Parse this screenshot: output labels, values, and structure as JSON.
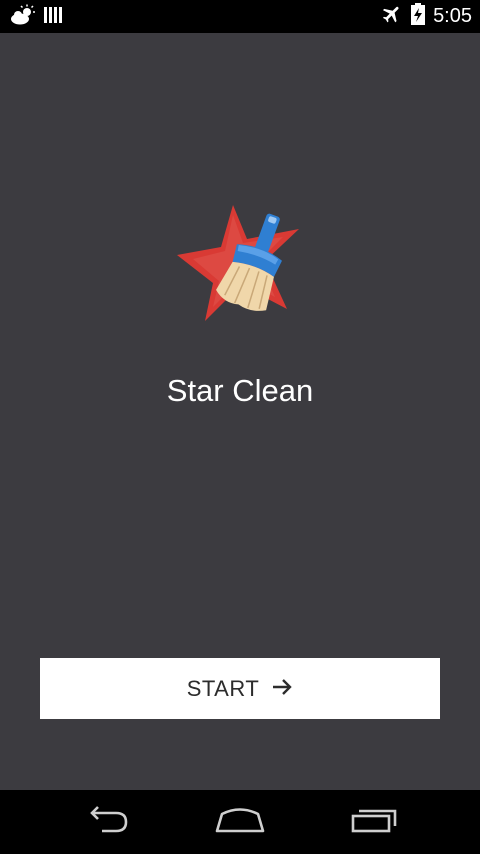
{
  "status_bar": {
    "time": "5:05",
    "icons": [
      "weather-icon",
      "signal-bars-icon",
      "airplane-icon",
      "battery-charging-icon"
    ]
  },
  "app": {
    "name": "Star Clean",
    "logo": "star-broom-logo"
  },
  "start_button": {
    "label": "START",
    "icon": "arrow-right-icon"
  },
  "nav_bar": {
    "buttons": [
      "back-icon",
      "home-icon",
      "recents-icon"
    ]
  },
  "colors": {
    "background": "#3c3b40",
    "button_bg": "#ffffff",
    "star_red": "#d93a34",
    "broom_blue": "#2f7fd2",
    "bristle": "#f0d7aa"
  }
}
